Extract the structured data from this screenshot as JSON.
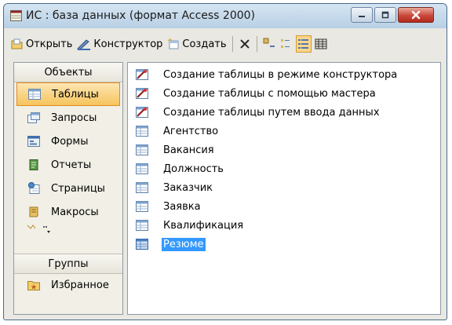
{
  "window": {
    "title": "ИС : база данных (формат Access 2000)"
  },
  "toolbar": {
    "open_label": "Открыть",
    "design_label": "Конструктор",
    "create_label": "Создать"
  },
  "sidebar": {
    "header": "Объекты",
    "items": [
      {
        "label": "Таблицы",
        "icon": "table-icon",
        "selected": true
      },
      {
        "label": "Запросы",
        "icon": "query-icon"
      },
      {
        "label": "Формы",
        "icon": "form-icon"
      },
      {
        "label": "Отчеты",
        "icon": "report-icon"
      },
      {
        "label": "Страницы",
        "icon": "page-icon"
      },
      {
        "label": "Макросы",
        "icon": "macro-icon"
      }
    ],
    "groups_header": "Группы",
    "favorites_label": "Избранное"
  },
  "objects": [
    {
      "label": "Создание таблицы в режиме конструктора",
      "icon": "wizard-icon"
    },
    {
      "label": "Создание таблицы с помощью мастера",
      "icon": "wizard-icon"
    },
    {
      "label": "Создание таблицы путем ввода данных",
      "icon": "wizard-icon"
    },
    {
      "label": "Агентство",
      "icon": "table-icon"
    },
    {
      "label": "Вакансия",
      "icon": "table-icon"
    },
    {
      "label": "Должность",
      "icon": "table-icon"
    },
    {
      "label": "Заказчик",
      "icon": "table-icon"
    },
    {
      "label": "Заявка",
      "icon": "table-icon"
    },
    {
      "label": "Квалификация",
      "icon": "table-icon"
    },
    {
      "label": "Резюме",
      "icon": "table-icon",
      "selected": true
    }
  ],
  "colors": {
    "selection": "#3399ff",
    "sidebar_selected": "#f6c45c",
    "close_button": "#c8483a"
  }
}
